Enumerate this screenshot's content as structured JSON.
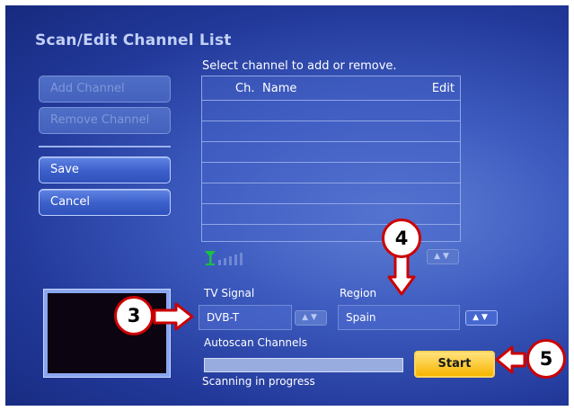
{
  "title": "Scan/Edit Channel List",
  "instruction": "Select channel to add or remove.",
  "buttons": {
    "add_channel": "Add Channel",
    "remove_channel": "Remove Channel",
    "save": "Save",
    "cancel": "Cancel",
    "start": "Start"
  },
  "channel_table": {
    "columns": {
      "ch": "Ch.",
      "name": "Name",
      "edit": "Edit"
    },
    "rows": []
  },
  "tv_signal": {
    "label": "TV Signal",
    "value": "DVB-T"
  },
  "region": {
    "label": "Region",
    "value": "Spain"
  },
  "autoscan": {
    "label": "Autoscan Channels",
    "status": "Scanning in progress",
    "progress": 0.0
  },
  "icons": {
    "arrows": "chevron-up-down-icon",
    "signal": "antenna-signal-icon"
  },
  "callouts": [
    "3",
    "4",
    "5"
  ],
  "colors": {
    "callout_red": "#cc0000",
    "start_yellow": "#f8b500",
    "signal_green": "#18c040"
  }
}
